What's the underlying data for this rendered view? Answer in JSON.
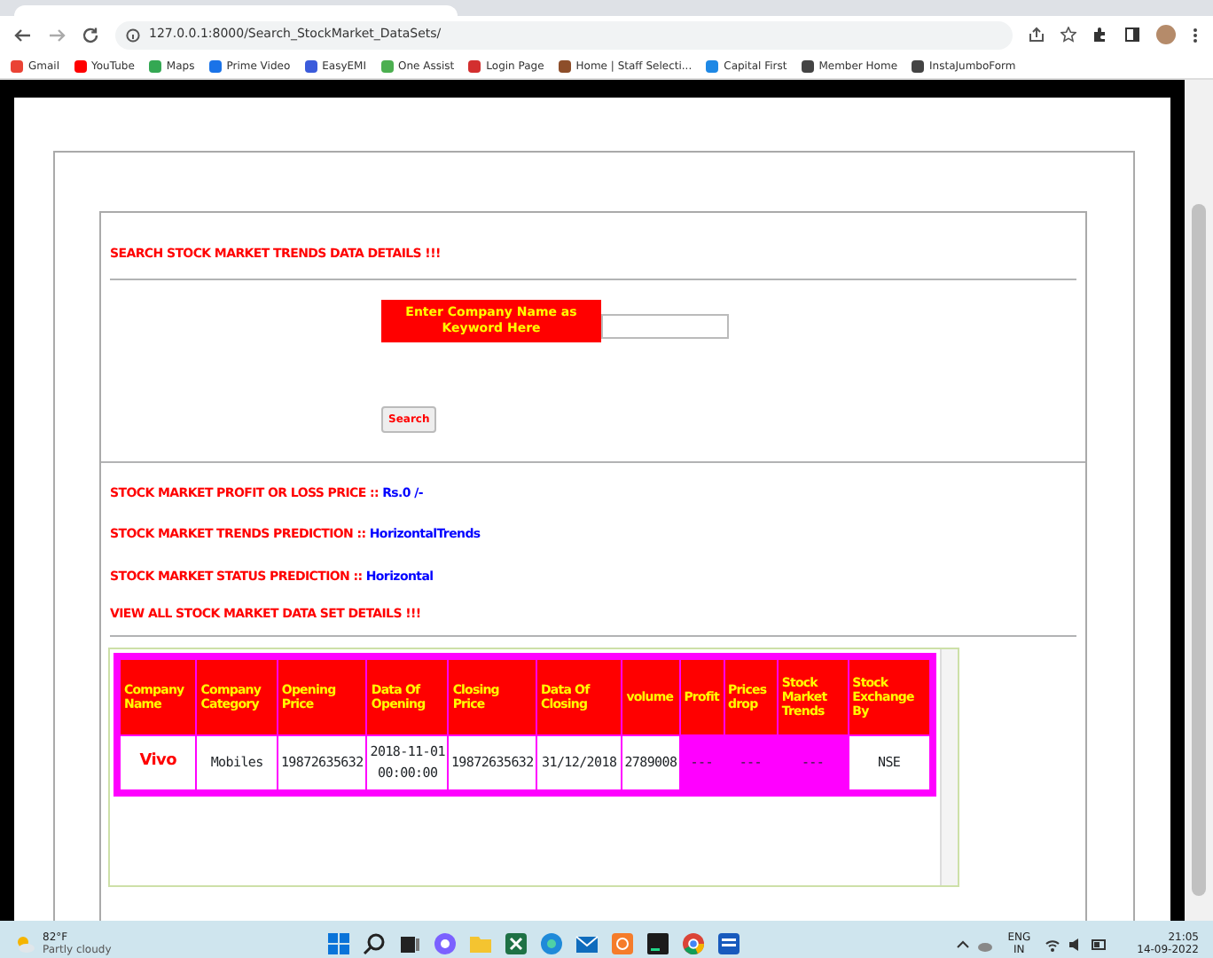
{
  "browser": {
    "address": "127.0.0.1:8000/Search_StockMarket_DataSets/",
    "bookmarks": [
      {
        "label": "Gmail",
        "color": "#ea4335"
      },
      {
        "label": "YouTube",
        "color": "#ff0000"
      },
      {
        "label": "Maps",
        "color": "#34a853"
      },
      {
        "label": "Prime Video",
        "color": "#1a73e8"
      },
      {
        "label": "EasyEMI",
        "color": "#3b5bdb"
      },
      {
        "label": "One Assist",
        "color": "#4caf50"
      },
      {
        "label": "Login Page",
        "color": "#d32f2f"
      },
      {
        "label": "Home | Staff Selecti...",
        "color": "#8d4e2a"
      },
      {
        "label": "Capital First",
        "color": "#1e88e5"
      },
      {
        "label": "Member Home",
        "color": "#444444"
      },
      {
        "label": "InstaJumboForm",
        "color": "#444444"
      }
    ]
  },
  "search_section": {
    "heading": "SEARCH STOCK MARKET TRENDS DATA DETAILS !!!",
    "field_label": "Enter Company Name as Keyword Here",
    "button": "Search"
  },
  "results": [
    {
      "label": "STOCK MARKET PROFIT OR LOSS PRICE ::",
      "value": "Rs.0 /-"
    },
    {
      "label": "STOCK MARKET TRENDS PREDICTION ::",
      "value": "HorizontalTrends"
    },
    {
      "label": "STOCK MARKET STATUS PREDICTION ::",
      "value": "Horizontal"
    }
  ],
  "table_heading": "VIEW ALL STOCK MARKET DATA SET DETAILS !!!",
  "table": {
    "columns": [
      "Company Name",
      "Company Category",
      "Opening Price",
      "Data Of Opening",
      "Closing Price",
      "Data Of Closing",
      "volume",
      "Profit",
      "Prices drop",
      "Stock Market Trends",
      "Stock Exchange By"
    ],
    "rows": [
      {
        "cells": [
          {
            "text": "Vivo",
            "kind": "name"
          },
          {
            "text": "Mobiles",
            "kind": "plain"
          },
          {
            "text": "19872635632",
            "kind": "plain"
          },
          {
            "text": "2018-11-01 00:00:00",
            "kind": "plain"
          },
          {
            "text": "19872635632",
            "kind": "plain"
          },
          {
            "text": "31/12/2018",
            "kind": "plain"
          },
          {
            "text": "2789008",
            "kind": "plain"
          },
          {
            "text": "---",
            "kind": "flag"
          },
          {
            "text": "---",
            "kind": "flag"
          },
          {
            "text": "---",
            "kind": "flag"
          },
          {
            "text": "NSE",
            "kind": "plain"
          }
        ]
      }
    ]
  },
  "taskbar": {
    "temperature": "82°F",
    "weather": "Partly cloudy",
    "language": "ENG",
    "region": "IN",
    "time": "21:05",
    "date": "14-09-2022"
  }
}
